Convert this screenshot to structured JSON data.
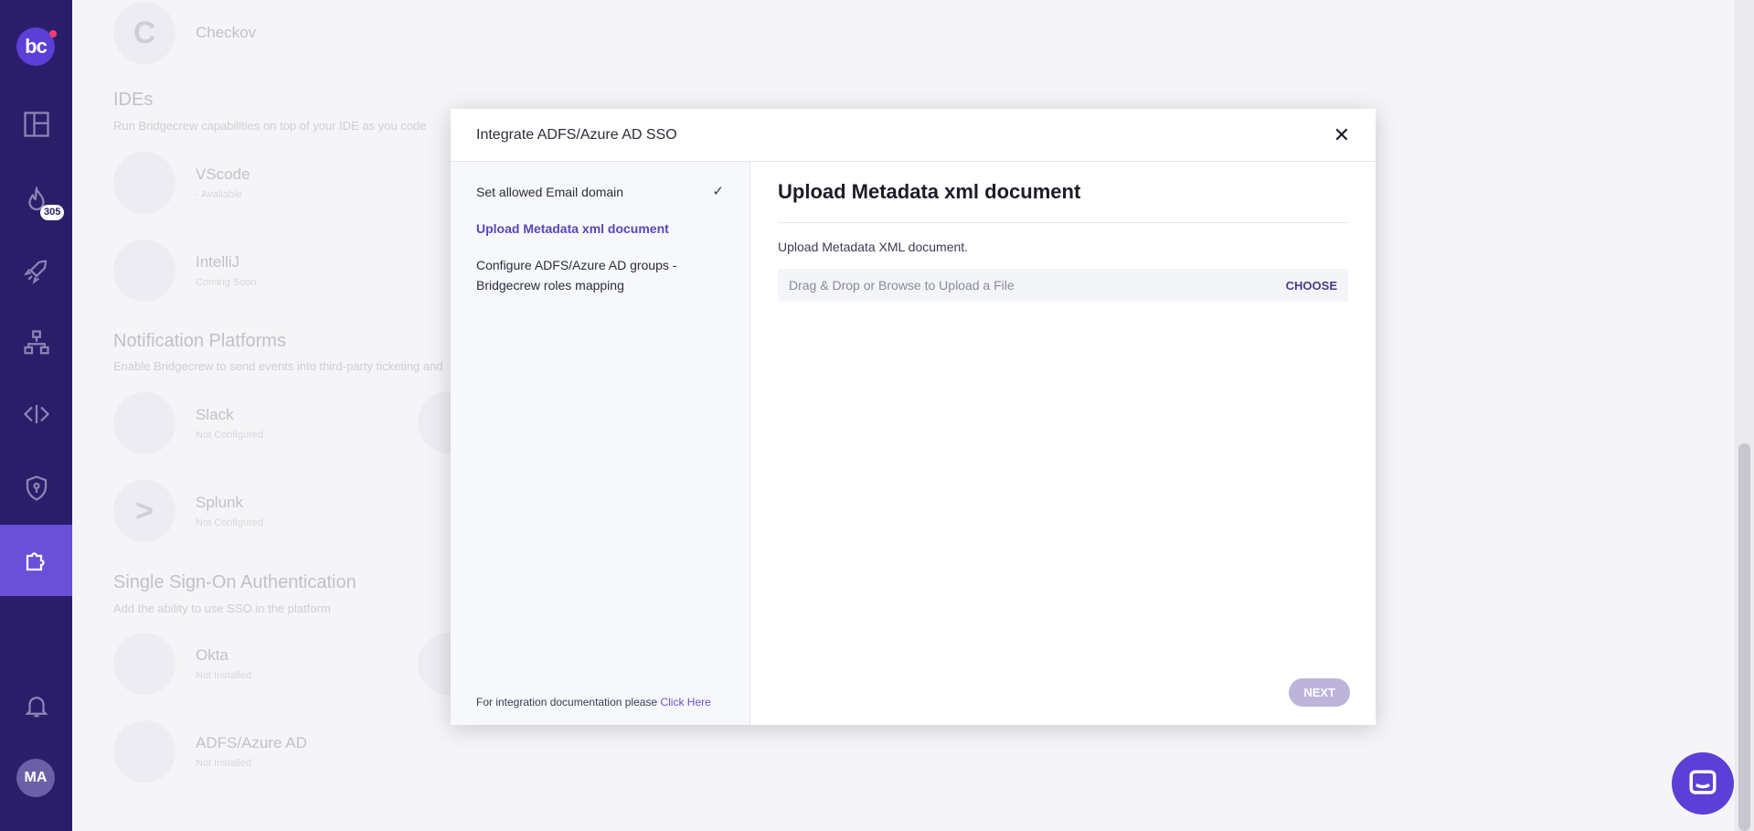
{
  "sidebar": {
    "logo_text": "bc",
    "badge_count": "305",
    "avatar_initials": "MA",
    "items": [
      {
        "icon": "dashboard-icon"
      },
      {
        "icon": "flame-icon"
      },
      {
        "icon": "rocket-icon"
      },
      {
        "icon": "hierarchy-icon"
      },
      {
        "icon": "code-icon"
      },
      {
        "icon": "shield-icon"
      },
      {
        "icon": "puzzle-icon"
      },
      {
        "icon": "bell-icon"
      }
    ]
  },
  "background": {
    "top_item": {
      "name": "Checkov",
      "letter": "C"
    },
    "ides": {
      "title": "IDEs",
      "subtitle": "Run Bridgecrew capabilities on top of your IDE as you code",
      "items": [
        {
          "name": "VScode",
          "state": "- Available"
        },
        {
          "name": "IntelliJ",
          "state": "Coming Soon"
        }
      ]
    },
    "notifications": {
      "title": "Notification Platforms",
      "subtitle": "Enable Bridgecrew to send events into third-party ticketing and",
      "items": [
        {
          "name": "Slack",
          "state": "Not Configured"
        },
        {
          "name": "Splunk",
          "state": "Not Configured",
          "letter": ">"
        }
      ]
    },
    "sso": {
      "title": "Single Sign-On Authentication",
      "subtitle": "Add the ability to use SSO in the platform",
      "items": [
        {
          "name": "Okta",
          "state": "Not Installed"
        },
        {
          "name": "ADFS/Azure AD",
          "state": "Not Installed"
        }
      ]
    }
  },
  "modal": {
    "title": "Integrate ADFS/Azure AD SSO",
    "steps": [
      {
        "label": "Set allowed Email domain"
      },
      {
        "label": "Upload Metadata xml document"
      },
      {
        "label": "Configure ADFS/Azure AD groups - Bridgecrew roles mapping"
      }
    ],
    "doc_note": "For integration documentation please",
    "doc_link": "Click Here",
    "content_title": "Upload Metadata xml document",
    "content_sub": "Upload Metadata XML document.",
    "upload_placeholder": "Drag & Drop or Browse to Upload a File",
    "choose_label": "CHOOSE",
    "next_label": "NEXT"
  },
  "colors": {
    "sidebar": "#2a1e6b",
    "accent": "#6a4fd8",
    "next_disabled": "#bdb4dc"
  }
}
